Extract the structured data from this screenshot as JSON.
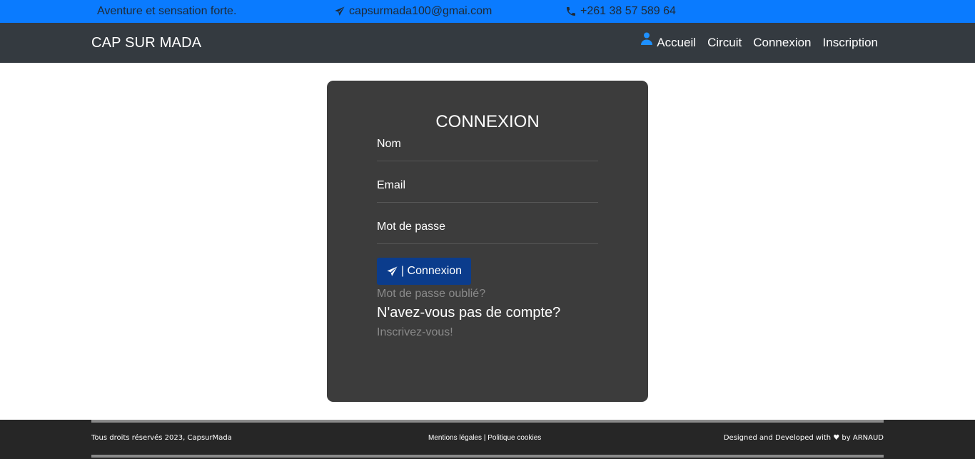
{
  "topbar": {
    "tagline": "Aventure et sensation forte.",
    "email": "capsurmada100@gmai.com",
    "phone": "+261 38 57 589 64",
    "email_icon": "paper-plane-icon",
    "phone_icon": "phone-icon",
    "bg_color": "#0a7bff"
  },
  "navbar": {
    "brand": "CAP SUR MADA",
    "user_icon": "user-icon",
    "items": [
      {
        "label": "Accueil"
      },
      {
        "label": "Circuit"
      },
      {
        "label": "Connexion"
      },
      {
        "label": "Inscription"
      }
    ],
    "bg_color": "#343a40"
  },
  "login": {
    "title": "CONNEXION",
    "fields": {
      "name_placeholder": "Nom",
      "email_placeholder": "Email",
      "password_placeholder": "Mot de passe"
    },
    "submit_label": "| Connexion",
    "submit_icon": "paper-plane-icon",
    "forgot_label": "Mot de passe oublié?",
    "no_account_text": "N'avez-vous pas de compte?",
    "signup_label": "Inscrivez-vous!",
    "button_color": "#0b3c8c",
    "card_color": "#3c3c3c"
  },
  "footer": {
    "copyright": "Tous droits réservés 2023, CapsurMada",
    "legal_label": "Mentions légales",
    "separator": "|",
    "cookies_label": "Politique cookies",
    "credit": "Designed and Developed with ♥ by ARNAUD"
  }
}
